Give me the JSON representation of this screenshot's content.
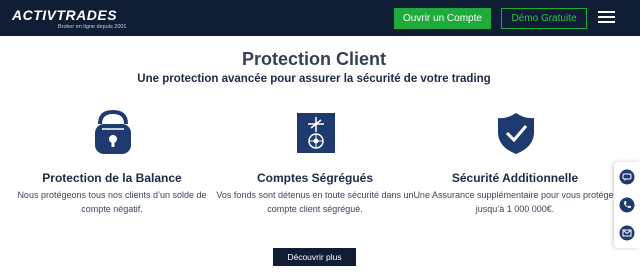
{
  "header": {
    "logo_text": "ACTIVTRADES",
    "logo_tagline": "Broker en ligne depuis 2001",
    "open_account_label": "Ouvrir un Compte",
    "demo_label": "Démo Gratuite",
    "menu_icon": "hamburger-icon",
    "colors": {
      "bar": "#0f1e35",
      "accent": "#1eab3c"
    }
  },
  "main": {
    "title": "Protection Client",
    "subtitle": "Une protection avancée pour assurer la sécurité de votre trading",
    "features": [
      {
        "icon": "padlock-balance-icon",
        "title": "Protection de la Balance",
        "text": "Nous protégeons tous nos clients d’un solde de compte négatif."
      },
      {
        "icon": "segregated-accounts-icon",
        "title": "Comptes Ségrégués",
        "text": "Vos fonds sont détenus en toute sécurité dans un compte client ségrégué."
      },
      {
        "icon": "shield-check-icon",
        "title": "Sécurité Additionnelle",
        "text": "Une Assurance supplémentaire pour vous protéger jusqu’à 1 000 000€."
      }
    ],
    "cta_label": "Découvrir plus"
  },
  "side_tabs": [
    {
      "icon": "chat-icon"
    },
    {
      "icon": "phone-icon"
    },
    {
      "icon": "mail-icon"
    }
  ]
}
